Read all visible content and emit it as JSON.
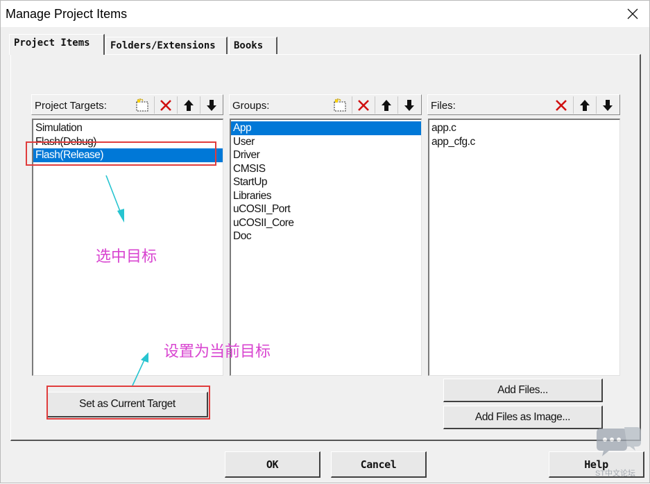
{
  "window": {
    "title": "Manage Project Items"
  },
  "tabs": [
    {
      "label": "Project Items",
      "active": true
    },
    {
      "label": "Folders/Extensions",
      "active": false
    },
    {
      "label": "Books",
      "active": false
    }
  ],
  "targets": {
    "header": "Project Targets:",
    "items": [
      "Simulation",
      "Flash(Debug)",
      "Flash(Release)"
    ],
    "selected": "Flash(Release)"
  },
  "groups": {
    "header": "Groups:",
    "items": [
      "App",
      "User",
      "Driver",
      "CMSIS",
      "StartUp",
      "Libraries",
      "uCOSII_Port",
      "uCOSII_Core",
      "Doc"
    ],
    "selected": "App"
  },
  "files": {
    "header": "Files:",
    "items": [
      "app.c",
      "app_cfg.c"
    ]
  },
  "buttons": {
    "set_current_target": "Set as Current Target",
    "add_files": "Add Files...",
    "add_files_as_image": "Add Files as Image...",
    "ok": "OK",
    "cancel": "Cancel",
    "help": "Help"
  },
  "annotations": {
    "select_target": "选中目标",
    "set_current_target": "设置为当前目标",
    "highlight_color": "#e03c3c",
    "text_color": "#d844d0",
    "arrow_color": "#27c4d0"
  },
  "watermark": {
    "text": "ST中文论坛"
  },
  "colors": {
    "selection": "#0078d7",
    "dialog_bg": "#f0f0f0",
    "delete_icon": "#d01010"
  }
}
